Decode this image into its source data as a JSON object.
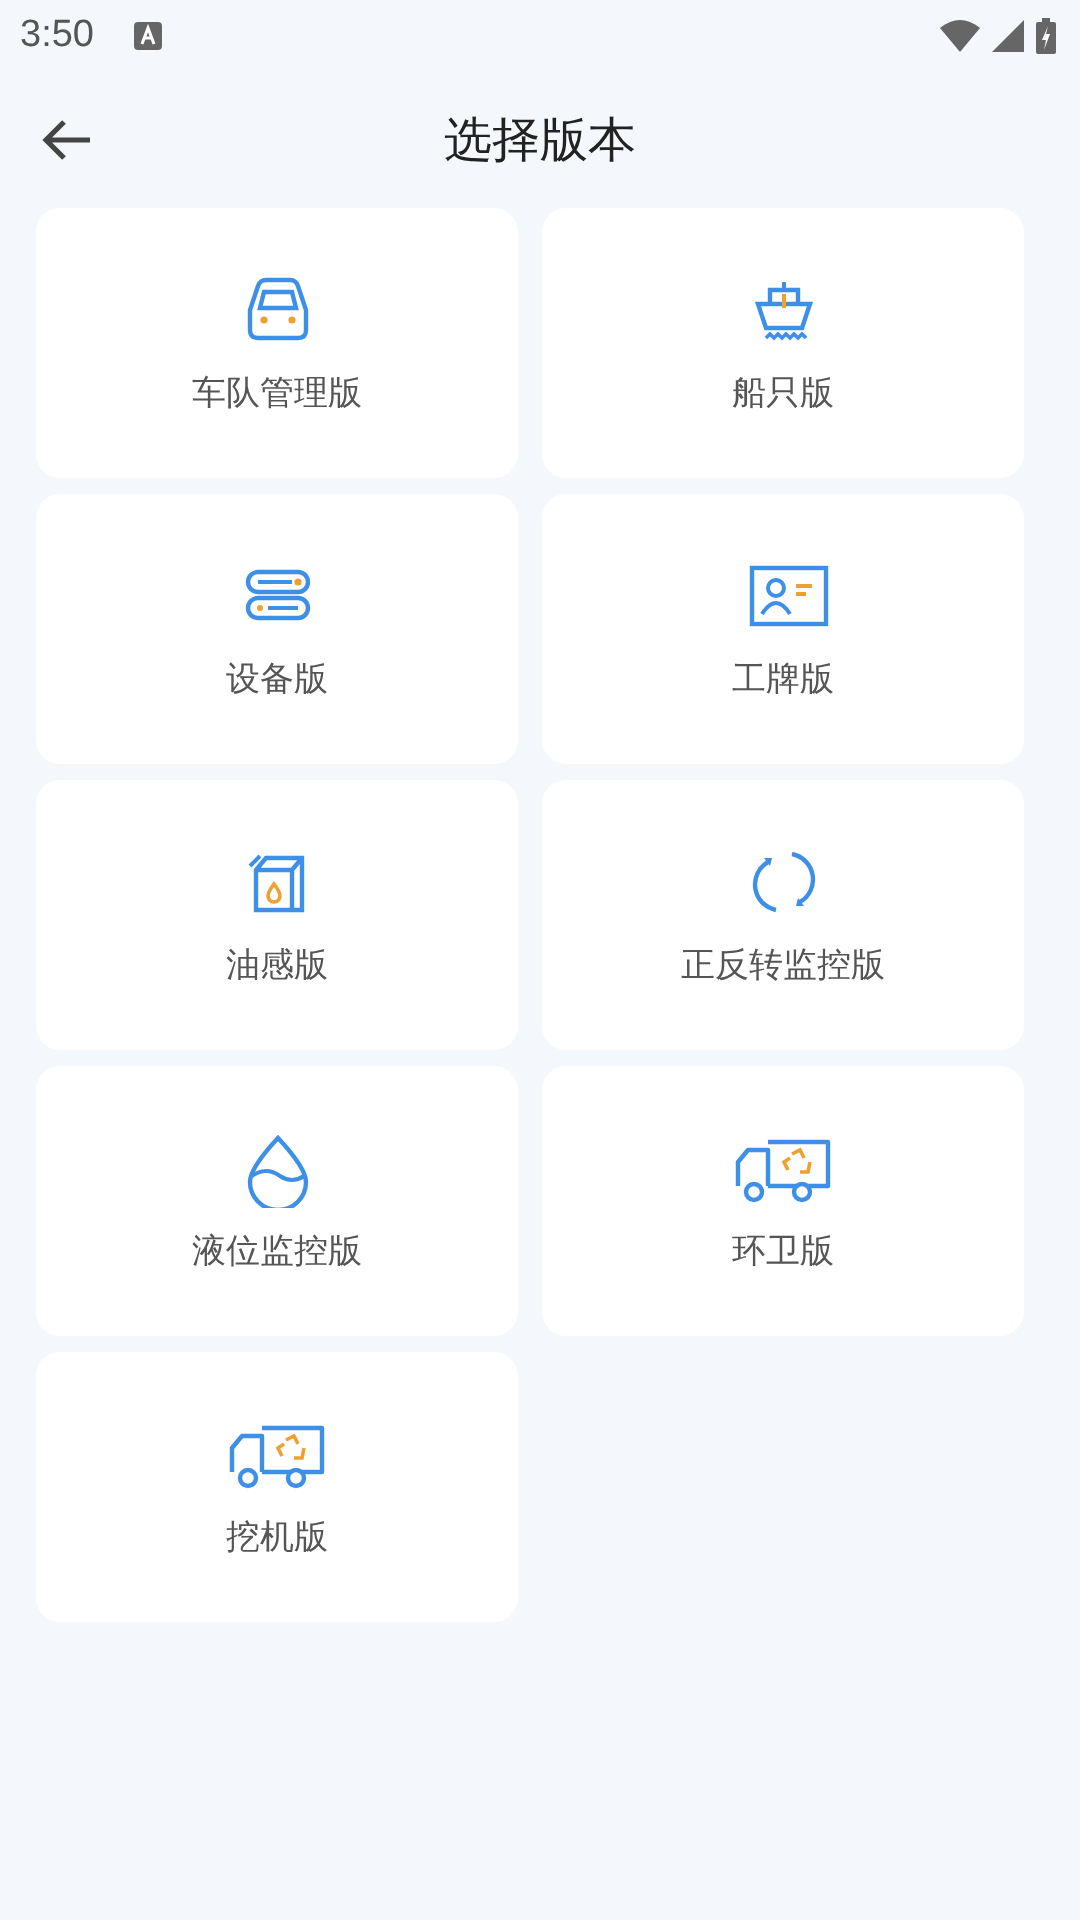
{
  "status_bar": {
    "time": "3:50"
  },
  "header": {
    "title": "选择版本"
  },
  "versions": [
    {
      "label": "车队管理版",
      "kind": "car"
    },
    {
      "label": "船只版",
      "kind": "ship"
    },
    {
      "label": "设备版",
      "kind": "server"
    },
    {
      "label": "工牌版",
      "kind": "badge"
    },
    {
      "label": "油感版",
      "kind": "oil"
    },
    {
      "label": "正反转监控版",
      "kind": "rotate"
    },
    {
      "label": "液位监控版",
      "kind": "drop"
    },
    {
      "label": "环卫版",
      "kind": "truck"
    },
    {
      "label": "挖机版",
      "kind": "truck"
    }
  ]
}
